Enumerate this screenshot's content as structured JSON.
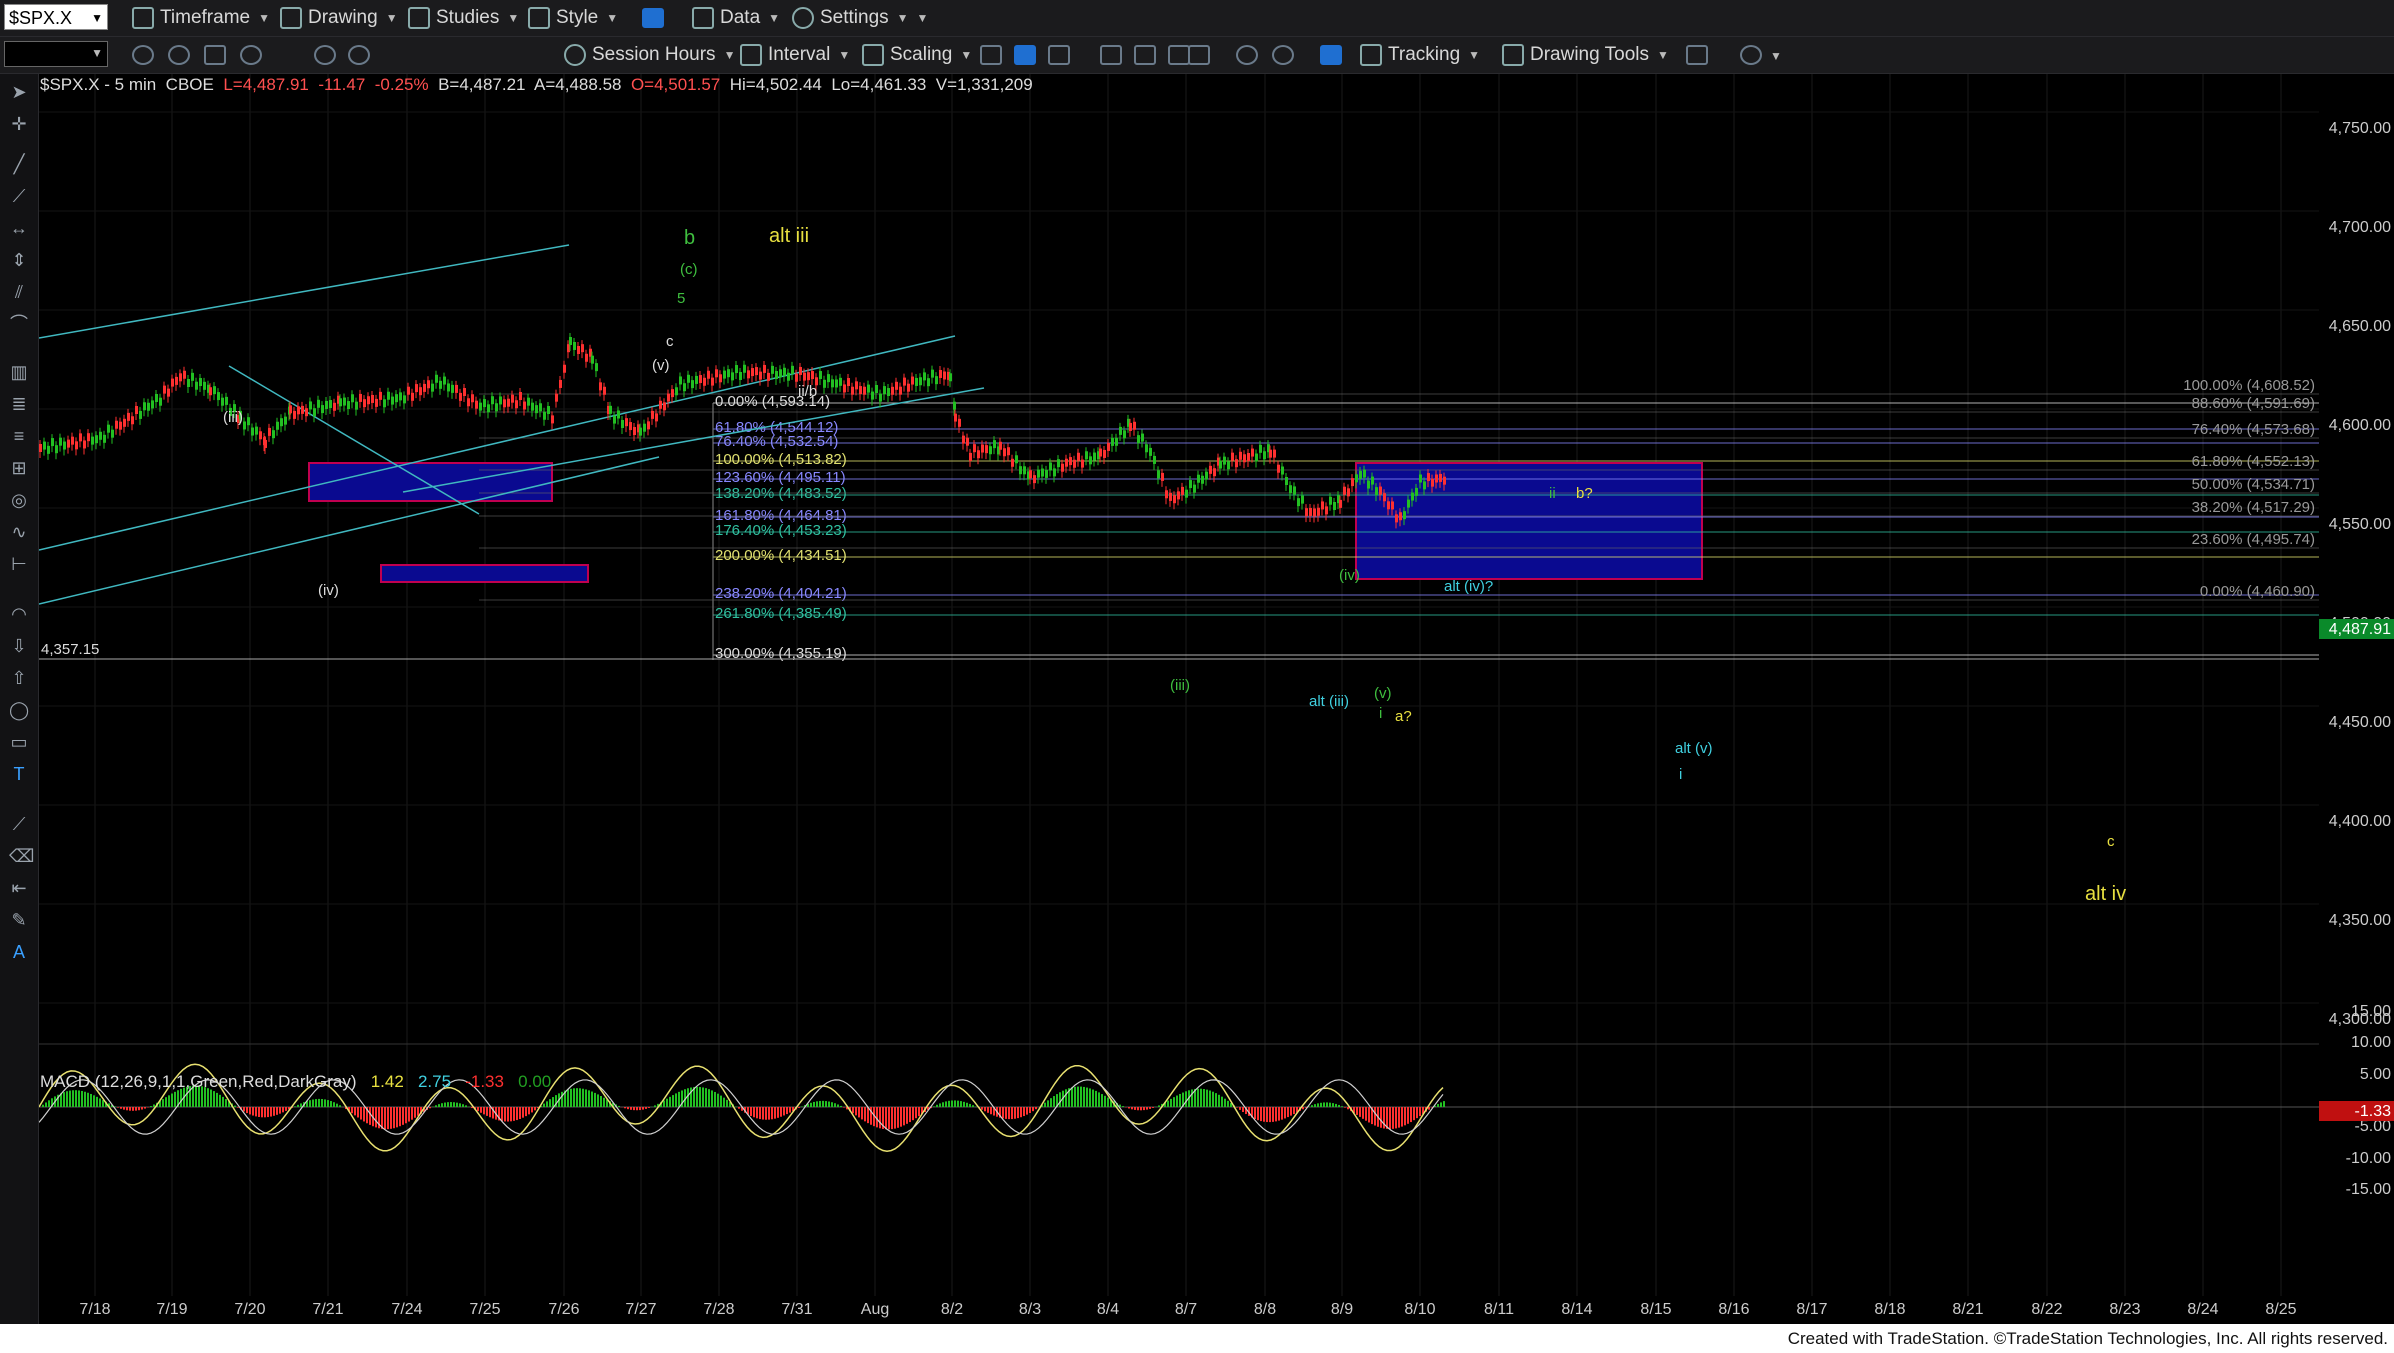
{
  "toolbar_top": {
    "symbol": "$SPX.X",
    "items": [
      "Timeframe",
      "Drawing",
      "Studies",
      "Style",
      "Data",
      "Settings"
    ]
  },
  "toolbar_second": {
    "items": [
      "Session Hours",
      "Interval",
      "Scaling",
      "Tracking",
      "Drawing Tools"
    ]
  },
  "chart_info": {
    "symbol": "$SPX.X - 5 min",
    "exchange": "CBOE",
    "last": "L=4,487.91",
    "change": "-11.47",
    "pct": "-0.25%",
    "bid": "B=4,487.21",
    "ask": "A=4,488.58",
    "open": "O=4,501.57",
    "high": "Hi=4,502.44",
    "low": "Lo=4,461.33",
    "volume": "V=1,331,209"
  },
  "macd_info": {
    "label": "MACD (12,26,9,1,1,Green,Red,DarkGray)",
    "v1": "1.42",
    "v2": "2.75",
    "v3": "-1.33",
    "v4": "0.00"
  },
  "price_axis": {
    "ticks": [
      "4,750.00",
      "4,700.00",
      "4,650.00",
      "4,600.00",
      "4,550.00",
      "4,500.00",
      "4,450.00",
      "4,400.00",
      "4,350.00",
      "4,300.00"
    ],
    "current": "4,487.91",
    "macd_ticks": [
      "15.00",
      "10.00",
      "5.00",
      "-5.00",
      "-10.00",
      "-15.00"
    ],
    "macd_current": "-1.33"
  },
  "date_axis": [
    "7/18",
    "7/19",
    "7/20",
    "7/21",
    "7/24",
    "7/25",
    "7/26",
    "7/27",
    "7/28",
    "7/31",
    "Aug",
    "8/2",
    "8/3",
    "8/4",
    "8/7",
    "8/8",
    "8/9",
    "8/10",
    "8/11",
    "8/14",
    "8/15",
    "8/16",
    "8/17",
    "8/18",
    "8/21",
    "8/22",
    "8/23",
    "8/24",
    "8/25"
  ],
  "fib_left": [
    {
      "t": "0.00% (4,593.14)",
      "c": "#dddddd"
    },
    {
      "t": "61.80% (4,544.12)",
      "c": "#8888ff"
    },
    {
      "t": "76.40% (4,532.54)",
      "c": "#8888ff"
    },
    {
      "t": "100.00% (4,513.82)",
      "c": "#e0e070"
    },
    {
      "t": "123.60% (4,495.11)",
      "c": "#8888ff"
    },
    {
      "t": "138.20% (4,483.52)",
      "c": "#30c0a0"
    },
    {
      "t": "161.80% (4,464.81)",
      "c": "#8888ff"
    },
    {
      "t": "176.40% (4,453.23)",
      "c": "#30c0a0"
    },
    {
      "t": "200.00% (4,434.51)",
      "c": "#e0e070"
    },
    {
      "t": "238.20% (4,404.21)",
      "c": "#8888ff"
    },
    {
      "t": "261.80% (4,385.49)",
      "c": "#30c0a0"
    },
    {
      "t": "300.00% (4,355.19)",
      "c": "#dddddd"
    }
  ],
  "fib_right": [
    "100.00% (4,608.52)",
    "88.60% (4,591.69)",
    "76.40% (4,573.68)",
    "61.80% (4,552.13)",
    "50.00% (4,534.71)",
    "38.20% (4,517.29)",
    "23.60% (4,495.74)",
    "0.00% (4,460.90)"
  ],
  "level_label": "4,357.15",
  "wave_labels": [
    {
      "t": "b",
      "c": "#3fbf3f"
    },
    {
      "t": "(c)",
      "c": "#3fbf3f"
    },
    {
      "t": "5",
      "c": "#3fbf3f"
    },
    {
      "t": "alt iii",
      "c": "#e8e040"
    },
    {
      "t": "c",
      "c": "#dddddd"
    },
    {
      "t": "(v)",
      "c": "#dddddd"
    },
    {
      "t": "(iii)",
      "c": "#dddddd"
    },
    {
      "t": "(iv)",
      "c": "#dddddd"
    },
    {
      "t": "ii/b",
      "c": "#dddddd"
    },
    {
      "t": "(iv)",
      "c": "#3fbf3f"
    },
    {
      "t": "(iii)",
      "c": "#3fbf3f"
    },
    {
      "t": "alt (iii)",
      "c": "#40d0e0"
    },
    {
      "t": "(v)",
      "c": "#3fbf3f"
    },
    {
      "t": "i",
      "c": "#3fbf3f"
    },
    {
      "t": "a?",
      "c": "#e8e040"
    },
    {
      "t": "alt (iv)?",
      "c": "#40d0e0"
    },
    {
      "t": "ii",
      "c": "#3fbf3f"
    },
    {
      "t": "b?",
      "c": "#e8e040"
    },
    {
      "t": "alt (v)",
      "c": "#40d0e0"
    },
    {
      "t": "i",
      "c": "#40d0e0"
    },
    {
      "t": "c",
      "c": "#e8e040"
    },
    {
      "t": "alt iv",
      "c": "#e8e040"
    }
  ],
  "footer": "Created with TradeStation. ©TradeStation Technologies, Inc. All rights reserved.",
  "colors": {
    "up": "#22c022",
    "down": "#ff3030",
    "channel": "#40b8c0",
    "zone": "#0a0a90",
    "zone_border": "#c00050"
  }
}
